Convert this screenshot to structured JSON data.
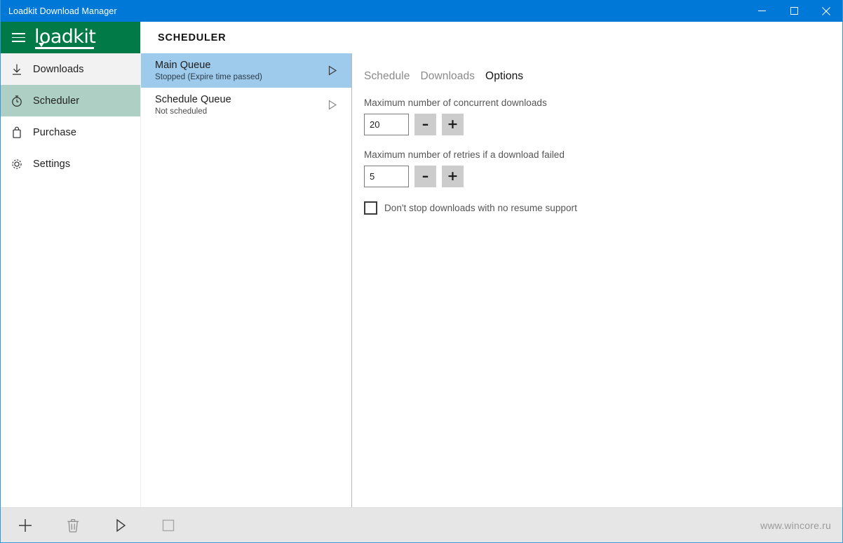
{
  "window": {
    "title": "Loadkit Download Manager",
    "titlebar_color": "#0078d7",
    "controls": {
      "minimize": "minimize-button",
      "maximize": "maximize-button",
      "close": "close-button"
    }
  },
  "brand": {
    "logo_text": "loadkit",
    "brand_color": "#017a47",
    "menu_icon": "hamburger-icon"
  },
  "sidebar": {
    "items": [
      {
        "label": "Downloads",
        "icon": "download-arrow-icon",
        "state": "hover"
      },
      {
        "label": "Scheduler",
        "icon": "stopwatch-icon",
        "state": "selected"
      },
      {
        "label": "Purchase",
        "icon": "shopping-bag-icon",
        "state": "normal"
      },
      {
        "label": "Settings",
        "icon": "gear-icon",
        "state": "normal"
      }
    ],
    "selected_color": "#aecfc4",
    "hover_color": "#f2f2f2"
  },
  "header": {
    "page_title": "SCHEDULER"
  },
  "queue_list": {
    "selected_color": "#9ecbeb",
    "items": [
      {
        "name": "Main Queue",
        "status": "Stopped (Expire time passed)",
        "action_icon": "play-icon",
        "selected": true
      },
      {
        "name": "Schedule Queue",
        "status": "Not scheduled",
        "action_icon": "play-icon",
        "selected": false
      }
    ]
  },
  "options": {
    "tabs": [
      {
        "label": "Schedule",
        "active": false
      },
      {
        "label": "Downloads",
        "active": false
      },
      {
        "label": "Options",
        "active": true
      }
    ],
    "fields": [
      {
        "label": "Maximum number of concurrent downloads",
        "value": "20",
        "placeholder": "",
        "decrement_label": "–",
        "increment_label": "+"
      },
      {
        "label": "Maximum number of retries if a download failed",
        "value": "5",
        "placeholder": "",
        "decrement_label": "–",
        "increment_label": "+"
      }
    ],
    "checkbox": {
      "label": "Don't stop downloads with no resume support",
      "checked": false
    }
  },
  "bottombar": {
    "background": "#e6e6e6",
    "buttons": [
      {
        "name": "add-button",
        "icon": "plus-icon"
      },
      {
        "name": "delete-button",
        "icon": "trash-icon"
      },
      {
        "name": "start-button",
        "icon": "play-icon"
      },
      {
        "name": "stop-button",
        "icon": "stop-square-icon"
      }
    ],
    "watermark": "www.wincore.ru"
  }
}
